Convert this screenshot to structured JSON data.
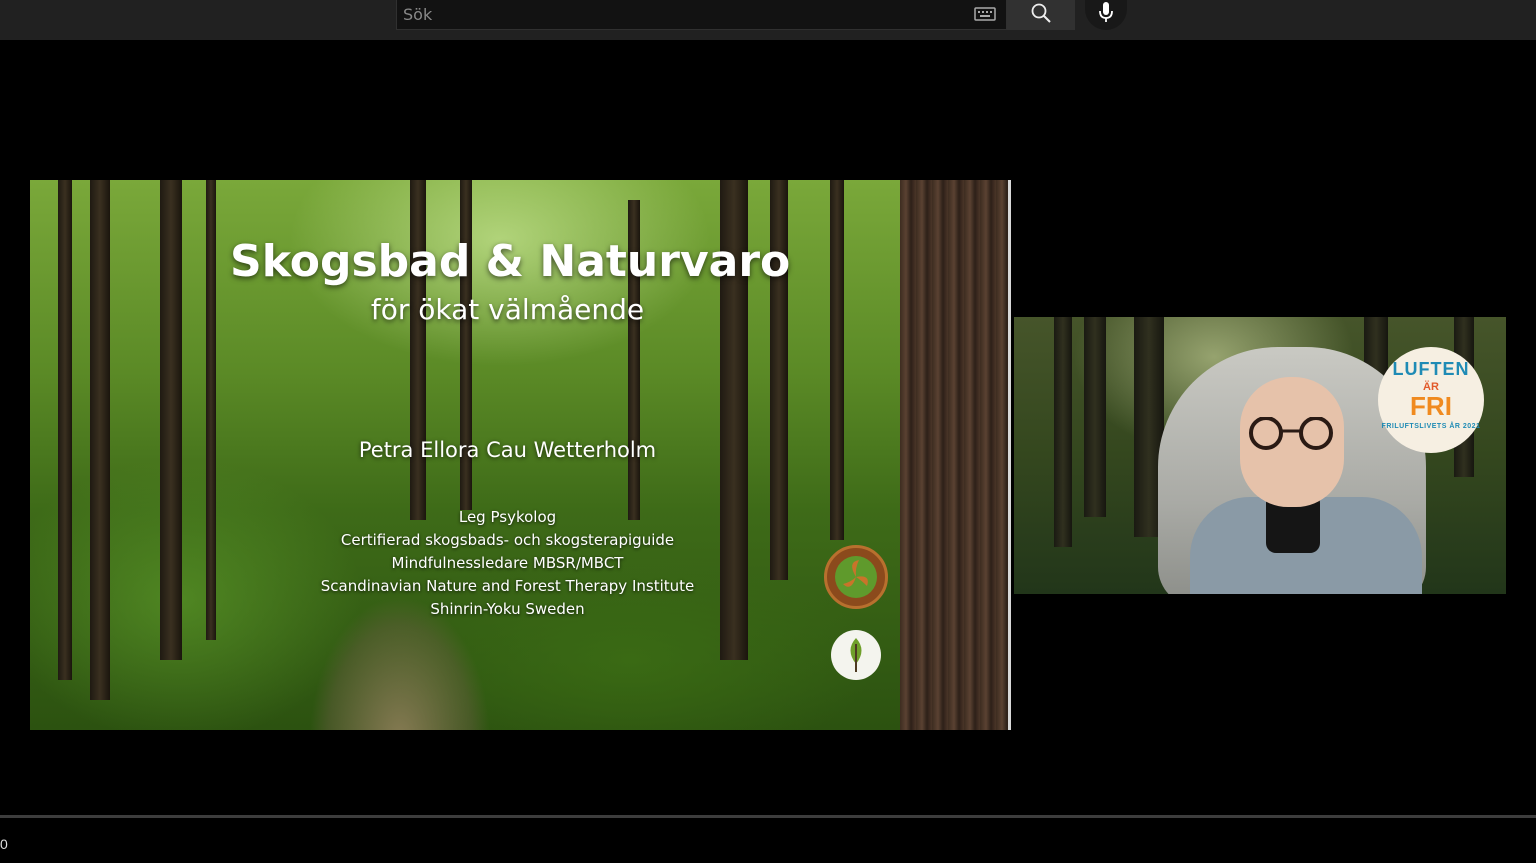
{
  "search": {
    "placeholder": "Sök"
  },
  "icons": {
    "keyboard": "keyboard-icon",
    "search": "search-icon",
    "mic": "microphone-icon"
  },
  "slide": {
    "title": "Skogsbad & Naturvaro",
    "subtitle": "för ökat välmående",
    "name": "Petra Ellora Cau Wetterholm",
    "credentials": [
      "Leg Psykolog",
      "Certifierad skogsbads- och skogsterapiguide",
      "Mindfulnessledare MBSR/MBCT",
      "Scandinavian Nature and Forest Therapy Institute",
      "Shinrin-Yoku Sweden"
    ]
  },
  "webcam": {
    "badge": {
      "top": "LUFTEN",
      "middle": "ÄR",
      "bottom": "FRI",
      "ring": "FRILUFTSLIVETS ÅR 2021"
    }
  },
  "player": {
    "time": "0"
  },
  "colors": {
    "topbar": "#212121",
    "badge_blue": "#1f8bb5",
    "badge_orange": "#f08a1f"
  }
}
